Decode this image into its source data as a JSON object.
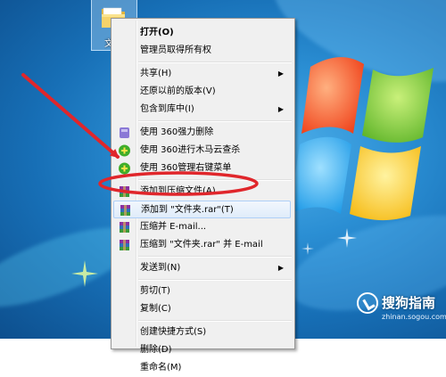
{
  "desktop": {
    "folder_label": "文件夹"
  },
  "context_menu": {
    "items": [
      {
        "label": "打开(O)",
        "bold": true
      },
      {
        "label": "管理员取得所有权"
      },
      {
        "label": "共享(H)",
        "submenu": true
      },
      {
        "label": "还原以前的版本(V)"
      },
      {
        "label": "包含到库中(I)",
        "submenu": true
      },
      {
        "label": "使用 360强力删除",
        "icon": "360-purple-icon"
      },
      {
        "label": "使用 360进行木马云查杀",
        "icon": "360-green-icon"
      },
      {
        "label": "使用 360管理右键菜单",
        "icon": "360-green-icon"
      },
      {
        "label": "添加到压缩文件(A)...",
        "icon": "winrar-icon"
      },
      {
        "label": "添加到 \"文件夹.rar\"(T)",
        "icon": "winrar-icon"
      },
      {
        "label": "压缩并 E-mail...",
        "icon": "winrar-icon"
      },
      {
        "label": "压缩到 \"文件夹.rar\" 并 E-mail",
        "icon": "winrar-icon"
      },
      {
        "label": "发送到(N)",
        "submenu": true
      },
      {
        "label": "剪切(T)"
      },
      {
        "label": "复制(C)"
      },
      {
        "label": "创建快捷方式(S)"
      },
      {
        "label": "删除(D)"
      },
      {
        "label": "重命名(M)"
      }
    ]
  },
  "watermark": {
    "title": "搜狗指南",
    "url": "zhinan.sogou.com"
  },
  "colors": {
    "annotation_red": "#e0262b",
    "menu_bg": "#f0f0f0",
    "highlight_border": "#aecff7"
  }
}
